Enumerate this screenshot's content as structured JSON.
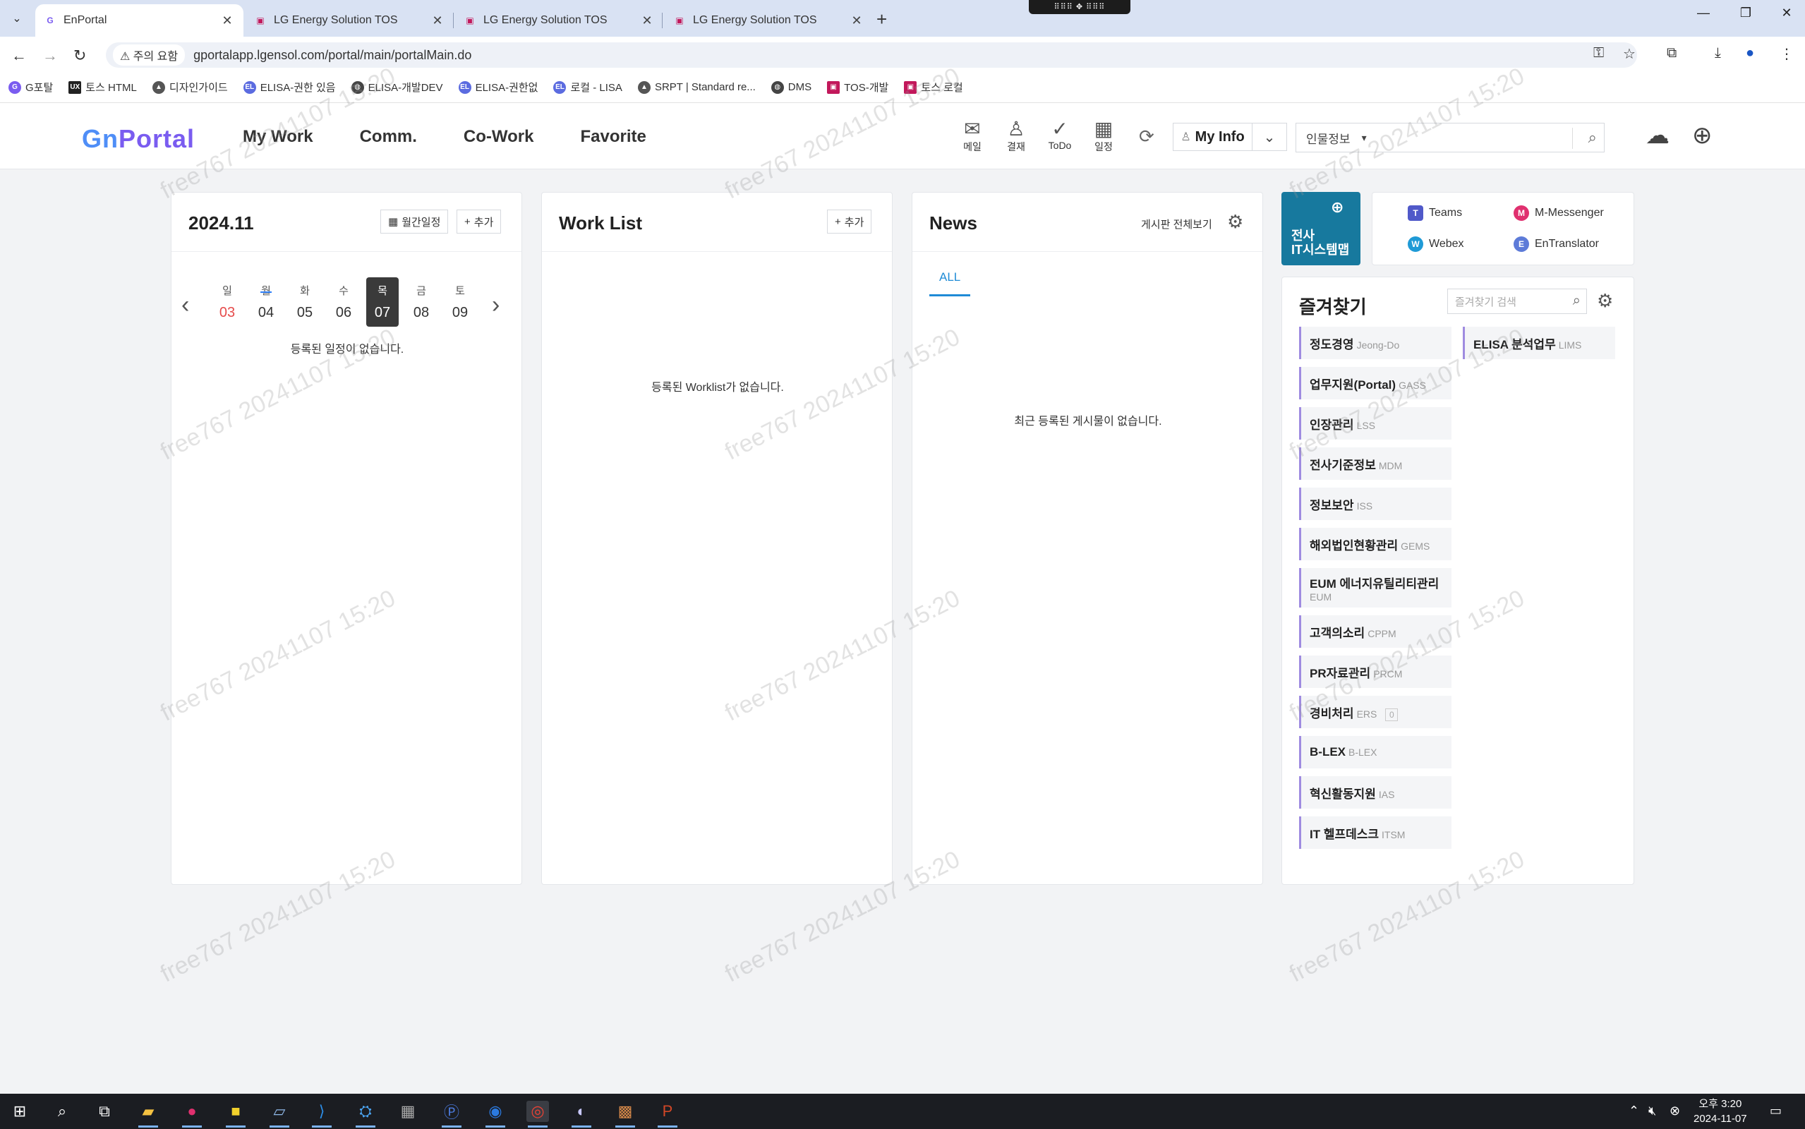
{
  "browser": {
    "tabs": [
      {
        "label": "EnPortal",
        "active": true
      },
      {
        "label": "LG Energy Solution TOS",
        "active": false
      },
      {
        "label": "LG Energy Solution TOS",
        "active": false
      },
      {
        "label": "LG Energy Solution TOS",
        "active": false
      }
    ],
    "security_label": "주의 요함",
    "url": "gportalapp.lgensol.com/portal/main/portalMain.do",
    "bookmarks": [
      "G포탈",
      "토스 HTML",
      "디자인가이드",
      "ELISA-권한 있음",
      "ELISA-개발DEV",
      "ELISA-권한없",
      "로컬 - LISA",
      "SRPT | Standard re...",
      "DMS",
      "TOS-개발",
      "토스 로컬"
    ]
  },
  "header": {
    "logo_text": "Portal",
    "nav": [
      "My Work",
      "Comm.",
      "Co-Work",
      "Favorite"
    ],
    "icons": [
      {
        "label": "메일",
        "icon": "mail-icon"
      },
      {
        "label": "결재",
        "icon": "approval-icon"
      },
      {
        "label": "ToDo",
        "icon": "check-icon"
      },
      {
        "label": "일정",
        "icon": "calendar-icon"
      }
    ],
    "myinfo_label": "My Info",
    "search_category": "인물정보"
  },
  "calendar": {
    "title": "2024.11",
    "monthly_button": "월간일정",
    "add_button": "추가",
    "days": [
      {
        "name": "일",
        "date": "03"
      },
      {
        "name": "월",
        "date": "04"
      },
      {
        "name": "화",
        "date": "05"
      },
      {
        "name": "수",
        "date": "06"
      },
      {
        "name": "목",
        "date": "07"
      },
      {
        "name": "금",
        "date": "08"
      },
      {
        "name": "토",
        "date": "09"
      }
    ],
    "empty_text": "등록된 일정이 없습니다."
  },
  "worklist": {
    "title": "Work List",
    "add_button": "추가",
    "empty_text": "등록된 Worklist가 없습니다."
  },
  "news": {
    "title": "News",
    "view_all": "게시판 전체보기",
    "tab_all": "ALL",
    "empty_text": "최근 등록된 게시물이 없습니다."
  },
  "it_systems": {
    "main_line1": "전사",
    "main_line2": "IT시스템맵",
    "links": [
      "Teams",
      "M-Messenger",
      "Webex",
      "EnTranslator"
    ]
  },
  "favorites": {
    "title": "즐겨찾기",
    "search_placeholder": "즐겨찾기 검색",
    "left": [
      {
        "name": "정도경영",
        "code": "Jeong-Do"
      },
      {
        "name": "업무지원(Portal)",
        "code": "GASS"
      },
      {
        "name": "인장관리",
        "code": "LSS"
      },
      {
        "name": "전사기준정보",
        "code": "MDM"
      },
      {
        "name": "정보보안",
        "code": "ISS"
      },
      {
        "name": "해외법인현황관리",
        "code": "GEMS"
      },
      {
        "name": "EUM 에너지유틸리티관리",
        "code": "EUM"
      },
      {
        "name": "고객의소리",
        "code": "CPPM"
      },
      {
        "name": "PR자료관리",
        "code": "PRCM"
      },
      {
        "name": "경비처리",
        "code": "ERS"
      },
      {
        "name": "B-LEX",
        "code": "B-LEX"
      },
      {
        "name": "혁신활동지원",
        "code": "IAS"
      },
      {
        "name": "IT 헬프데스크",
        "code": "ITSM"
      }
    ],
    "right": [
      {
        "name": "ELISA 분석업무",
        "code": "LIMS"
      }
    ],
    "ers_badge": "0"
  },
  "watermark": "free767 20241107 15:20",
  "taskbar": {
    "time": "오후 3:20",
    "date": "2024-11-07"
  },
  "colors": {
    "accent": "#1f8bd6",
    "it_block": "#17799e",
    "fav_bar": "#9f8be0",
    "today": "#3a3a3a",
    "sunday": "#e64b4b"
  }
}
